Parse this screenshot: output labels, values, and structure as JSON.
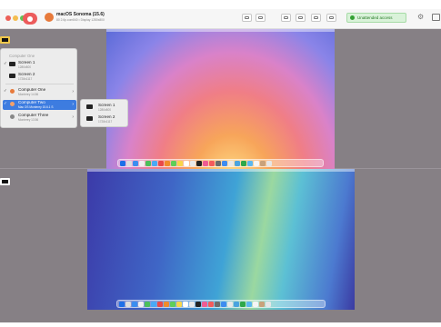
{
  "titlebar": {
    "title": "macOS Sonoma (15.6)",
    "subtitle": "80 2.6p.com840 • Display 1280x800",
    "access_label": "Unattended access",
    "colors": {
      "record": "#ec5c5c",
      "access_bg": "#d9f2d9",
      "access_text": "#257a25"
    }
  },
  "menu": {
    "header": "Computer One",
    "items": [
      {
        "label": "Screen 1",
        "sub": "1280x800",
        "checked": true
      },
      {
        "label": "Screen 2",
        "sub": "1728x1117",
        "checked": false
      },
      {
        "label": "Computer One",
        "sub": "Monterey 14.56",
        "checked": true
      },
      {
        "label": "Computer Two",
        "sub": "Mac OS Monterey 15.6.1 S",
        "checked": false
      },
      {
        "label": "Computer Three",
        "sub": "Monterey 13.56",
        "checked": false
      }
    ]
  },
  "submenu": {
    "items": [
      {
        "label": "Screen 1",
        "sub": "1280x800"
      },
      {
        "label": "Screen 2",
        "sub": "1728x1117"
      }
    ]
  },
  "colors": {
    "canvas": "#868085",
    "selection": "#3d7ce0",
    "chip_top": "#f2c84b",
    "chip_bottom": "#ffffff"
  }
}
